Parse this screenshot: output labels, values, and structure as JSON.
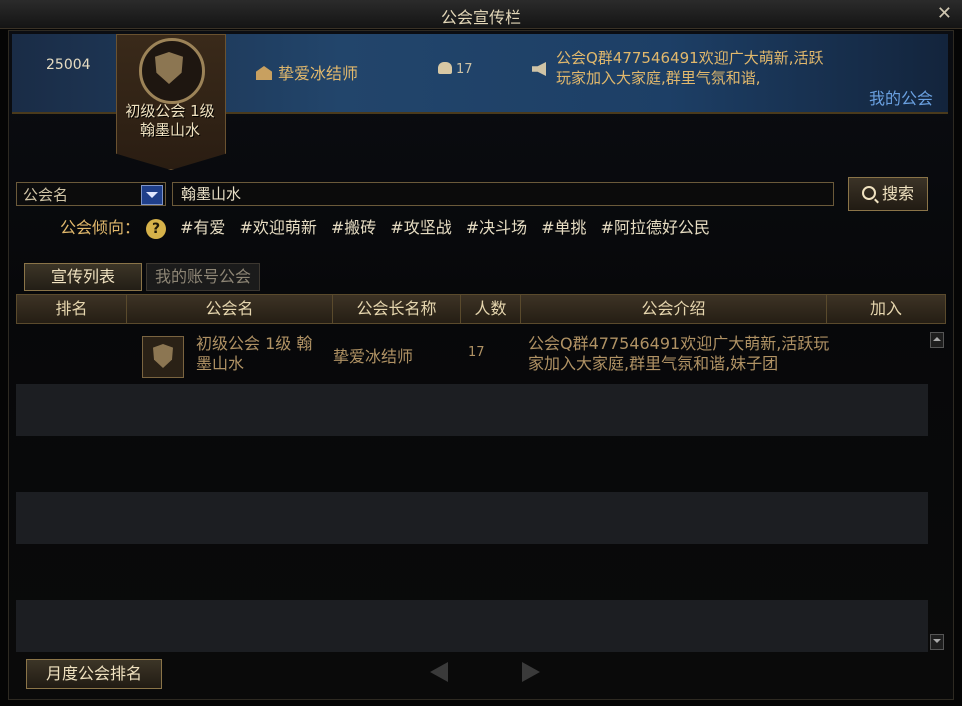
{
  "window": {
    "title": "公会宣传栏",
    "close": "✕"
  },
  "banner": {
    "id": "25004",
    "guild_name": "初级公会 1级 翰墨山水",
    "leader": "挚爱冰结师",
    "members": "17",
    "announcement": "公会Q群477546491欢迎广大萌新,活跃玩家加入大家庭,群里气氛和谐,",
    "my_guild": "我的公会"
  },
  "search": {
    "category": "公会名",
    "value": "翰墨山水",
    "button": "搜索"
  },
  "tags": {
    "label": "公会倾向：",
    "help": "?",
    "items": [
      "#有爱",
      "#欢迎萌新",
      "#搬砖",
      "#攻坚战",
      "#决斗场",
      "#单挑",
      "#阿拉德好公民"
    ]
  },
  "tabs": [
    "宣传列表",
    "我的账号公会"
  ],
  "table": {
    "headers": [
      "排名",
      "公会名",
      "公会长名称",
      "人数",
      "公会介绍",
      "加入"
    ],
    "rows": [
      {
        "guild": "初级公会 1级 翰墨山水",
        "leader": "挚爱冰结师",
        "count": "17",
        "intro": "公会Q群477546491欢迎广大萌新,活跃玩家加入大家庭,群里气氛和谐,妹子团"
      }
    ]
  },
  "footer": {
    "monthly": "月度公会排名"
  }
}
